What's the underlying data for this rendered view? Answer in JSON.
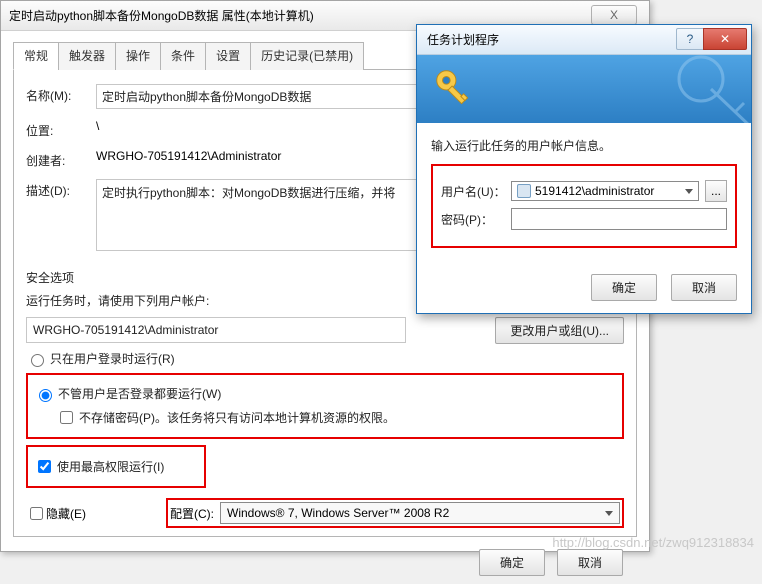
{
  "main": {
    "title": "定时启动python脚本备份MongoDB数据 属性(本地计算机)",
    "close_glyph": "X",
    "tabs": [
      "常规",
      "触发器",
      "操作",
      "条件",
      "设置",
      "历史记录(已禁用)"
    ],
    "active_tab": 0,
    "name_label": "名称(M):",
    "name_value": "定时启动python脚本备份MongoDB数据",
    "location_label": "位置:",
    "location_value": "\\",
    "author_label": "创建者:",
    "author_value": "WRGHO-705191412\\Administrator",
    "desc_label": "描述(D):",
    "desc_value": "定时执行python脚本：对MongoDB数据进行压缩，并将",
    "security": {
      "title": "安全选项",
      "run_as_prompt": "运行任务时，请使用下列用户帐户:",
      "user": "WRGHO-705191412\\Administrator",
      "change_user_btn": "更改用户或组(U)...",
      "radio_logged_on": "只在用户登录时运行(R)",
      "radio_any": "不管用户是否登录都要运行(W)",
      "chk_nostore": "不存储密码(P)。该任务将只有访问本地计算机资源的权限。",
      "chk_highest": "使用最高权限运行(I)",
      "radio_any_selected": true,
      "chk_highest_checked": true,
      "chk_nostore_checked": false
    },
    "hidden_label": "隐藏(E)",
    "config_label": "配置(C):",
    "config_value": "Windows® 7, Windows Server™ 2008 R2",
    "ok_btn": "确定",
    "cancel_btn": "取消"
  },
  "cred": {
    "title": "任务计划程序",
    "help_glyph": "?",
    "close_glyph": "✕",
    "prompt": "输入运行此任务的用户帐户信息。",
    "user_label": "用户名(U)：",
    "user_value": "5191412\\administrator",
    "pass_label": "密码(P)：",
    "browse_glyph": "...",
    "ok_btn": "确定",
    "cancel_btn": "取消"
  },
  "watermark": "http://blog.csdn.net/zwq912318834"
}
